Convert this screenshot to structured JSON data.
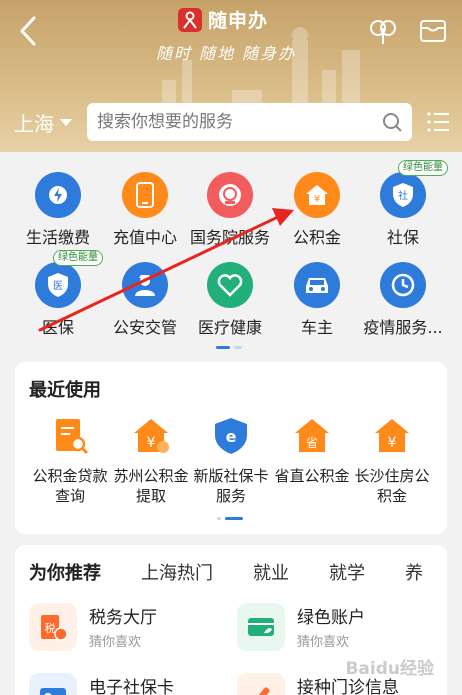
{
  "header": {
    "brand": "随申办",
    "slogan": "随时 随地 随身办",
    "city": "上海",
    "search_placeholder": "搜索你想要的服务"
  },
  "services": [
    {
      "label": "生活缴费",
      "color": "#2f7bdc",
      "icon": "lightning-icon"
    },
    {
      "label": "充值中心",
      "color": "#ff8a1a",
      "icon": "phone-icon"
    },
    {
      "label": "国务院服务",
      "color": "#f25c5c",
      "icon": "emblem-icon"
    },
    {
      "label": "公积金",
      "color": "#ff8a1a",
      "icon": "house-yuan-icon"
    },
    {
      "label": "社保",
      "color": "#2f7bdc",
      "icon": "shield-icon",
      "badge": "绿色能量"
    },
    {
      "label": "医保",
      "color": "#2f7bdc",
      "icon": "shield-medical-icon",
      "badge": "绿色能量"
    },
    {
      "label": "公安交管",
      "color": "#2f7bdc",
      "icon": "police-icon"
    },
    {
      "label": "医疗健康",
      "color": "#21b07a",
      "icon": "heart-icon"
    },
    {
      "label": "车主",
      "color": "#2f7bdc",
      "icon": "car-icon"
    },
    {
      "label": "疫情服务...",
      "color": "#2f7bdc",
      "icon": "clock-icon"
    }
  ],
  "recent": {
    "title": "最近使用",
    "items": [
      {
        "line1": "公积金贷款",
        "line2": "查询",
        "color": "#ff8a1a",
        "icon": "doc-search-icon"
      },
      {
        "line1": "苏州公积金",
        "line2": "提取",
        "color": "#ff8a1a",
        "icon": "house-yuan-icon"
      },
      {
        "line1": "新版社保卡",
        "line2": "服务",
        "color": "#2f7bdc",
        "icon": "e-shield-icon"
      },
      {
        "line1": "省直公积金",
        "line2": "",
        "color": "#ff8a1a",
        "icon": "house-sheng-icon"
      },
      {
        "line1": "长沙住房公",
        "line2": "积金",
        "color": "#ff8a1a",
        "icon": "house-yuan-icon"
      }
    ]
  },
  "recommend": {
    "tabs": [
      "为你推荐",
      "上海热门",
      "就业",
      "就学",
      "养"
    ],
    "items": [
      {
        "name": "税务大厅",
        "sub": "猜你喜欢",
        "color": "#ff6b2c",
        "icon": "tax-icon"
      },
      {
        "name": "绿色账户",
        "sub": "猜你喜欢",
        "color": "#21b07a",
        "icon": "card-leaf-icon"
      },
      {
        "name": "电子社保卡",
        "sub": "",
        "color": "#2f7bdc",
        "icon": "id-card-icon"
      },
      {
        "name": "接种门诊信息",
        "sub": "",
        "color": "#ff6b2c",
        "icon": "vaccine-icon"
      }
    ]
  },
  "watermark": "Baidu经验"
}
